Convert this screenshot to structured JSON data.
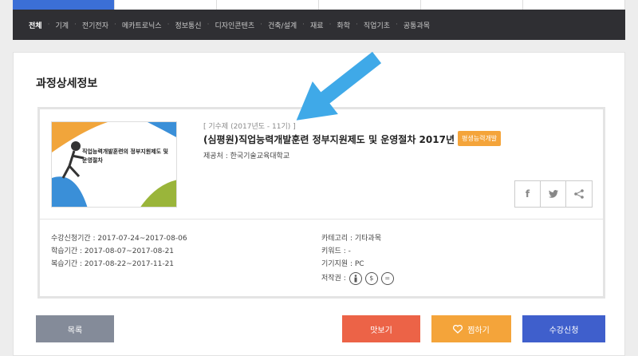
{
  "nav": {
    "categories": [
      {
        "label": "전체",
        "active": true
      },
      {
        "label": "기계"
      },
      {
        "label": "전기전자"
      },
      {
        "label": "메카트로닉스"
      },
      {
        "label": "정보통신"
      },
      {
        "label": "디자인콘텐츠"
      },
      {
        "label": "건축/설계"
      },
      {
        "label": "재료"
      },
      {
        "label": "화학"
      },
      {
        "label": "직업기초"
      },
      {
        "label": "공통과목"
      }
    ]
  },
  "page": {
    "title": "과정상세정보"
  },
  "course": {
    "period": "[ 기수제 (2017년도 - 11기) ]",
    "title": "(심평원)직업능력개발훈련 정부지원제도 및 운영절차 2017년",
    "badge": "평생능력개발",
    "provider": "제공처 : 한국기술교육대학교",
    "thumbnail_text": "직업능력개발훈련의 정부지원제도 및 운영절차",
    "share_icons": [
      "facebook-icon",
      "twitter-icon",
      "share-icon"
    ]
  },
  "details": {
    "enroll_period": "수강신청기간 : 2017-07-24~2017-08-06",
    "study_period": "학습기간 : 2017-08-07~2017-08-21",
    "review_period": "복습기간 : 2017-08-22~2017-11-21",
    "category": "카테고리 : 기타과목",
    "keyword": "키워드 : -",
    "device": "기기지원 : PC",
    "copyright_label": "저작권 :",
    "copyright_icons": [
      "cc-by-icon",
      "cc-nc-icon",
      "cc-nd-icon"
    ]
  },
  "buttons": {
    "list": "목록",
    "preview": "맛보기",
    "like": "찜하기",
    "apply": "수강신청"
  },
  "colors": {
    "nav_bg": "#2f2f33",
    "badge": "#f4a43a",
    "preview": "#ec6347",
    "like": "#f4a43a",
    "apply": "#3f5fcc",
    "list": "#848b99",
    "arrow": "#3fa9e8"
  }
}
